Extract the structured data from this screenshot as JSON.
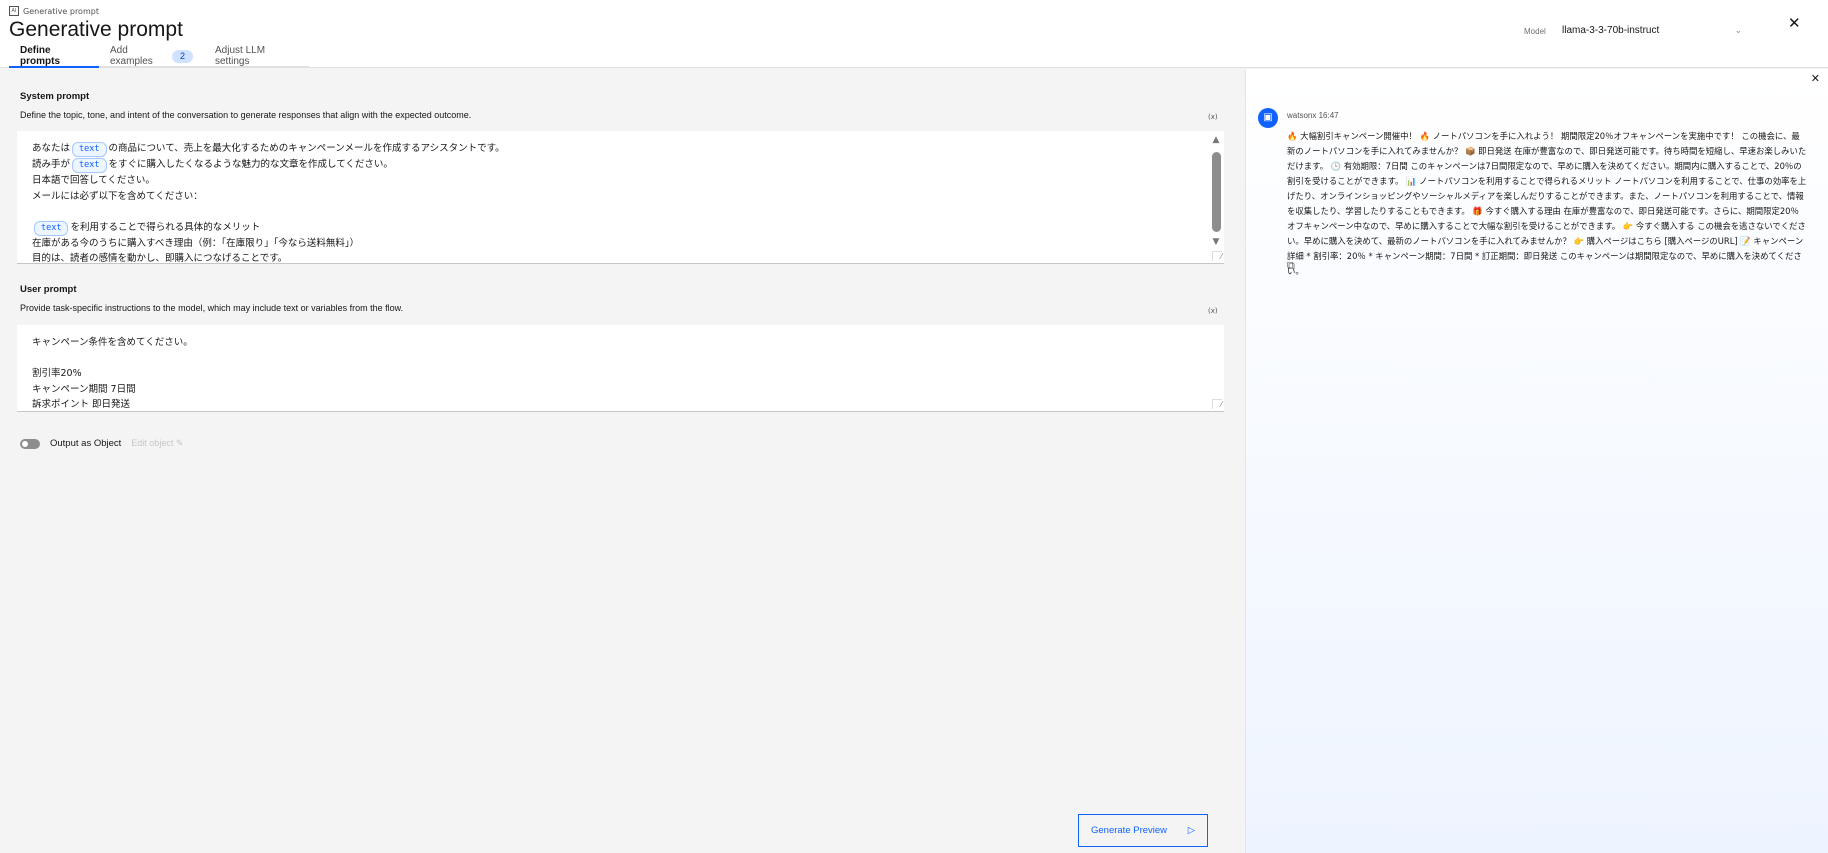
{
  "header": {
    "breadcrumb": "Generative prompt",
    "title": "Generative prompt",
    "tabs": [
      {
        "label": "Define prompts"
      },
      {
        "label": "Add examples",
        "badge": "2"
      },
      {
        "label": "Adjust LLM settings"
      }
    ],
    "model_label": "Model",
    "model_value": "llama-3-3-70b-instruct"
  },
  "system": {
    "title": "System prompt",
    "desc": "Define the topic, tone, and intent of the conversation to generate responses that align with the expected outcome.",
    "var_icon": "(x)",
    "chip": "text",
    "l1a": "あなたは",
    "l1b": "の商品について、売上を最大化するためのキャンペーンメールを作成するアシスタントです。",
    "l2a": "読み手が",
    "l2b": "をすぐに購入したくなるような魅力的な文章を作成してください。",
    "l3": "日本語で回答してください。",
    "l4": "メールには必ず以下を含めてください：",
    "l6b": "を利用することで得られる具体的なメリット",
    "l7": "在庫がある今のうちに購入すべき理由（例：「在庫限り」「今なら送料無料」）",
    "l8": "目的は、読者の感情を動かし、即購入につなげることです。"
  },
  "user": {
    "title": "User prompt",
    "desc": "Provide task-specific instructions to the model, which may include text or variables from the flow.",
    "var_icon": "(x)",
    "value": "キャンペーン条件を含めてください。\n\n割引率20%\nキャンペーン期間 7日間\n訴求ポイント 即日発送"
  },
  "output_toggle": {
    "label": "Output as Object",
    "on": false,
    "edit": "Edit object"
  },
  "generate_label": "Generate Preview",
  "chat": {
    "sender": "watsonx 16:47",
    "message": "🔥 大幅割引キャンペーン開催中！ 🔥 ノートパソコンを手に入れよう！ 期間限定20％オフキャンペーンを実施中です！ この機会に、最新のノートパソコンを手に入れてみませんか？ 📦 即日発送 在庫が豊富なので、即日発送可能です。待ち時間を短縮し、早速お楽しみいただけます。 🕒 有効期限：7日間 このキャンペーンは7日間限定なので、早めに購入を決めてください。期間内に購入することで、20％の割引を受けることができます。 📊 ノートパソコンを利用することで得られるメリット ノートパソコンを利用することで、仕事の効率を上げたり、オンラインショッピングやソーシャルメディアを楽しんだりすることができます。また、ノートパソコンを利用することで、情報を収集したり、学習したりすることもできます。 🎁 今すぐ購入する理由 在庫が豊富なので、即日発送可能です。さらに、期間限定20％オフキャンペーン中なので、早めに購入することで大幅な割引を受けることができます。 👉 今すぐ購入する この機会を逃さないでください。早めに購入を決めて、最新のノートパソコンを手に入れてみませんか？ 👉 購入ページはこちら [購入ページのURL] 📝 キャンペーン詳細 * 割引率：20％ * キャンペーン期間：7日間 * 訂正期間：即日発送 このキャンペーンは期間限定なので、早めに購入を決めてください。"
  },
  "colors": {
    "accent": "#0f62fe",
    "background": "#f4f4f4"
  }
}
